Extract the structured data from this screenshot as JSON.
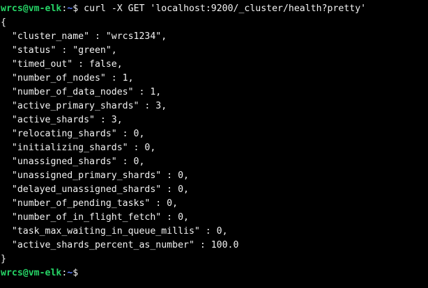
{
  "terminal": {
    "prompt": {
      "user": "wrcs",
      "at": "@",
      "host": "vm-elk",
      "separator": ":",
      "path": "~",
      "symbol": "$"
    },
    "command": " curl -X GET 'localhost:9200/_cluster/health?pretty'",
    "output_lines": [
      "{",
      "  \"cluster_name\" : \"wrcs1234\",",
      "  \"status\" : \"green\",",
      "  \"timed_out\" : false,",
      "  \"number_of_nodes\" : 1,",
      "  \"number_of_data_nodes\" : 1,",
      "  \"active_primary_shards\" : 3,",
      "  \"active_shards\" : 3,",
      "  \"relocating_shards\" : 0,",
      "  \"initializing_shards\" : 0,",
      "  \"unassigned_shards\" : 0,",
      "  \"unassigned_primary_shards\" : 0,",
      "  \"delayed_unassigned_shards\" : 0,",
      "  \"number_of_pending_tasks\" : 0,",
      "  \"number_of_in_flight_fetch\" : 0,",
      "  \"task_max_waiting_in_queue_millis\" : 0,",
      "  \"active_shards_percent_as_number\" : 100.0",
      "}"
    ],
    "colors": {
      "background": "#000000",
      "text": "#f2f2f2",
      "user_host": "#26d466",
      "path": "#5b7cff"
    }
  }
}
